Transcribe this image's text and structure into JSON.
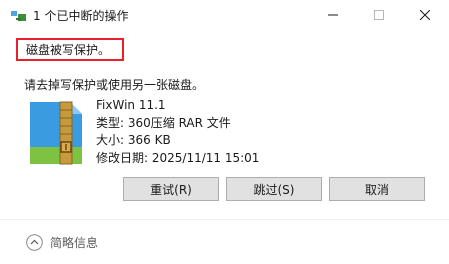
{
  "window": {
    "title": "1 个已中断的操作"
  },
  "dialog": {
    "error_message": "磁盘被写保护。",
    "instruction": "请去掉写保护或使用另一张磁盘。",
    "file": {
      "icon": "winrar-archive-icon",
      "name": "FixWin 11.1",
      "type_line": "类型: 360压缩 RAR 文件",
      "size_line": "大小: 366 KB",
      "modified_line": "修改日期: 2025/11/11 15:01"
    }
  },
  "buttons": {
    "retry": "重试(R)",
    "skip": "跳过(S)",
    "cancel": "取消"
  },
  "footer": {
    "details_label": "简略信息"
  },
  "colors": {
    "highlight_border": "#e8202a",
    "button_face": "#e1e1e1",
    "button_border": "#adadad"
  }
}
